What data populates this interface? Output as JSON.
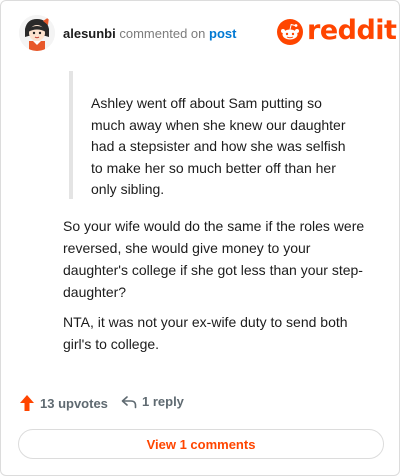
{
  "header": {
    "username": "alesunbi",
    "action_text": "commented on",
    "post_link": "post",
    "brand": "reddit"
  },
  "comment": {
    "quote": "Ashley went off about Sam putting so much away when she knew our daughter had a stepsister and how she was selfish to make her so much better off than her only sibling.",
    "paragraph_1": "So your wife would do the same if the roles were reversed, she would give money to your daughter's college if she got less than your step-daughter?",
    "paragraph_2": "NTA, it was not your ex-wife duty to send both girl's to college."
  },
  "actions": {
    "upvotes_label": "13 upvotes",
    "reply_label": "1 reply",
    "view_comments_label": "View 1 comments"
  },
  "colors": {
    "accent": "#ff4500",
    "link": "#0079d3",
    "muted": "#5f6a71"
  }
}
